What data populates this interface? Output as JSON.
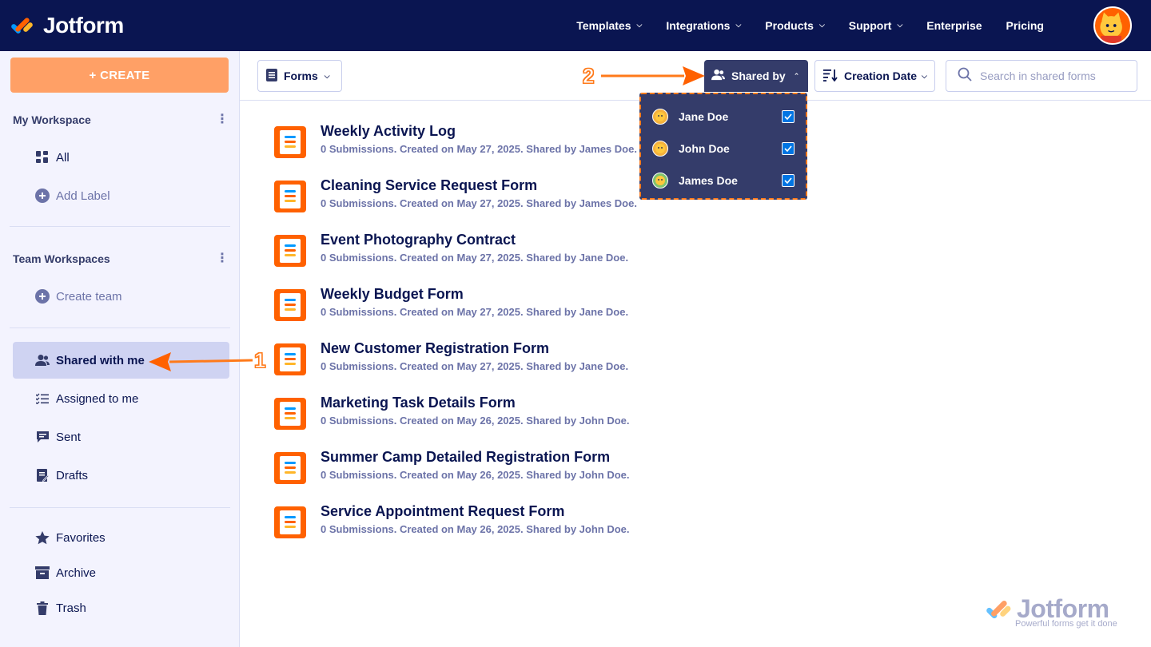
{
  "brand": {
    "name": "Jotform"
  },
  "nav": {
    "items": [
      {
        "label": "Templates",
        "dropdown": true
      },
      {
        "label": "Integrations",
        "dropdown": true
      },
      {
        "label": "Products",
        "dropdown": true
      },
      {
        "label": "Support",
        "dropdown": true
      },
      {
        "label": "Enterprise",
        "dropdown": false
      },
      {
        "label": "Pricing",
        "dropdown": false
      }
    ]
  },
  "sidebar": {
    "create_label": "+ CREATE",
    "my_workspace": "My Workspace",
    "all_label": "All",
    "add_label": "Add Label",
    "team_workspaces": "Team Workspaces",
    "create_team": "Create team",
    "shared_with_me": "Shared with me",
    "assigned_to_me": "Assigned to me",
    "sent": "Sent",
    "drafts": "Drafts",
    "favorites": "Favorites",
    "archive": "Archive",
    "trash": "Trash"
  },
  "toolbar": {
    "forms_label": "Forms",
    "shared_by_label": "Shared by",
    "sort_label": "Creation Date",
    "search_placeholder": "Search in shared forms"
  },
  "shared_by_dropdown": {
    "options": [
      {
        "name": "Jane Doe",
        "checked": true
      },
      {
        "name": "John Doe",
        "checked": true
      },
      {
        "name": "James Doe",
        "checked": true
      }
    ]
  },
  "forms": [
    {
      "title": "Weekly Activity Log",
      "meta": "0 Submissions. Created on May 27, 2025. Shared by James Doe."
    },
    {
      "title": "Cleaning Service Request Form",
      "meta": "0 Submissions. Created on May 27, 2025. Shared by James Doe."
    },
    {
      "title": "Event Photography Contract",
      "meta": "0 Submissions. Created on May 27, 2025. Shared by Jane Doe."
    },
    {
      "title": "Weekly Budget Form",
      "meta": "0 Submissions. Created on May 27, 2025. Shared by Jane Doe."
    },
    {
      "title": "New Customer Registration Form",
      "meta": "0 Submissions. Created on May 27, 2025. Shared by Jane Doe."
    },
    {
      "title": "Marketing Task Details Form",
      "meta": "0 Submissions. Created on May 26, 2025. Shared by John Doe."
    },
    {
      "title": "Summer Camp Detailed Registration Form",
      "meta": "0 Submissions. Created on May 26, 2025. Shared by John Doe."
    },
    {
      "title": "Service Appointment Request Form",
      "meta": "0 Submissions. Created on May 26, 2025. Shared by John Doe."
    }
  ],
  "annotations": {
    "step1": "1",
    "step2": "2"
  },
  "watermark": {
    "name": "Jotform",
    "tagline": "Powerful forms get it done"
  },
  "colors": {
    "navy": "#0a1551",
    "accent": "#ff6100",
    "create": "#ffa066",
    "highlight": "#ff7a1a",
    "checkbox": "#0075e3"
  }
}
